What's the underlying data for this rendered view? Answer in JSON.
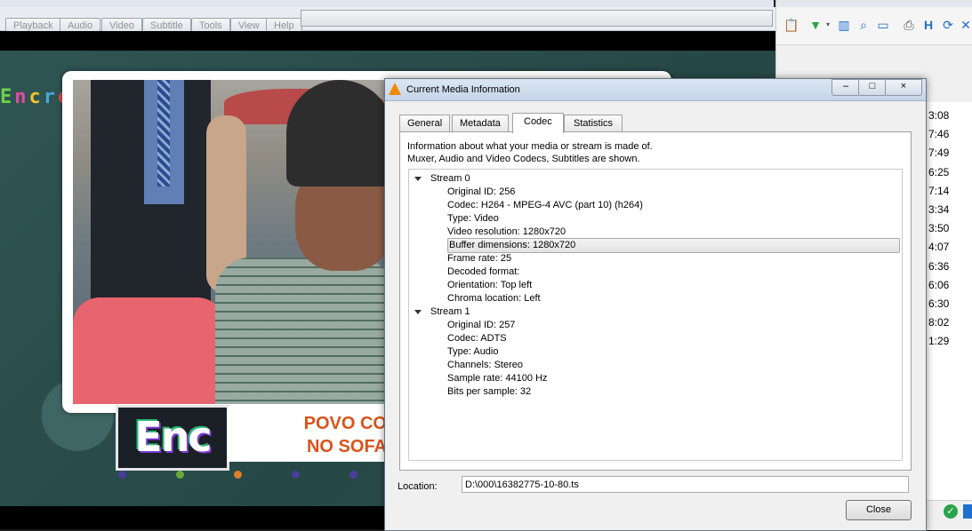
{
  "vlc": {
    "menus": [
      "Playback",
      "Audio",
      "Video",
      "Subtitle",
      "Tools",
      "View",
      "Help"
    ],
    "overlay": {
      "show_name": "Encrenca",
      "logo": "Enc",
      "ticker_line1": "POVO CO",
      "ticker_line2": "NO SOFA"
    }
  },
  "right_app": {
    "toolbar_icons": [
      "clipboard-icon",
      "filter-icon",
      "columns-icon",
      "search-icon",
      "window-icon",
      "printer-icon",
      "document-h-icon",
      "refresh-icon",
      "tools-icon"
    ],
    "times": [
      "3:08",
      "7:46",
      "7:49",
      "6:25",
      "7:14",
      "3:34",
      "3:50",
      "4:07",
      "6:36",
      "6:06",
      "6:30",
      "8:02",
      "1:29"
    ]
  },
  "dialog": {
    "title": "Current Media Information",
    "controls": {
      "minimize": "–",
      "maximize": "□",
      "close": "×"
    },
    "tabs": [
      {
        "label": "General",
        "active": false
      },
      {
        "label": "Metadata",
        "active": false
      },
      {
        "label": "Codec",
        "active": true
      },
      {
        "label": "Statistics",
        "active": false
      }
    ],
    "intro_line1": "Information about what your media or stream is made of.",
    "intro_line2": "Muxer, Audio and Video Codecs, Subtitles are shown.",
    "streams": [
      {
        "name": "Stream 0",
        "items": [
          "Original ID: 256",
          "Codec: H264 - MPEG-4 AVC (part 10) (h264)",
          "Type: Video",
          "Video resolution: 1280x720",
          "Buffer dimensions: 1280x720",
          "Frame rate: 25",
          "Decoded format: ",
          "Orientation: Top left",
          "Chroma location: Left"
        ]
      },
      {
        "name": "Stream 1",
        "items": [
          "Original ID: 257",
          "Codec: ADTS",
          "Type: Audio",
          "Channels: Stereo",
          "Sample rate: 44100 Hz",
          "Bits per sample: 32"
        ]
      }
    ],
    "selected_item": "Buffer dimensions: 1280x720",
    "location_label": "Location:",
    "location_value": "D:\\000\\16382775-10-80.ts",
    "close_label": "Close"
  }
}
